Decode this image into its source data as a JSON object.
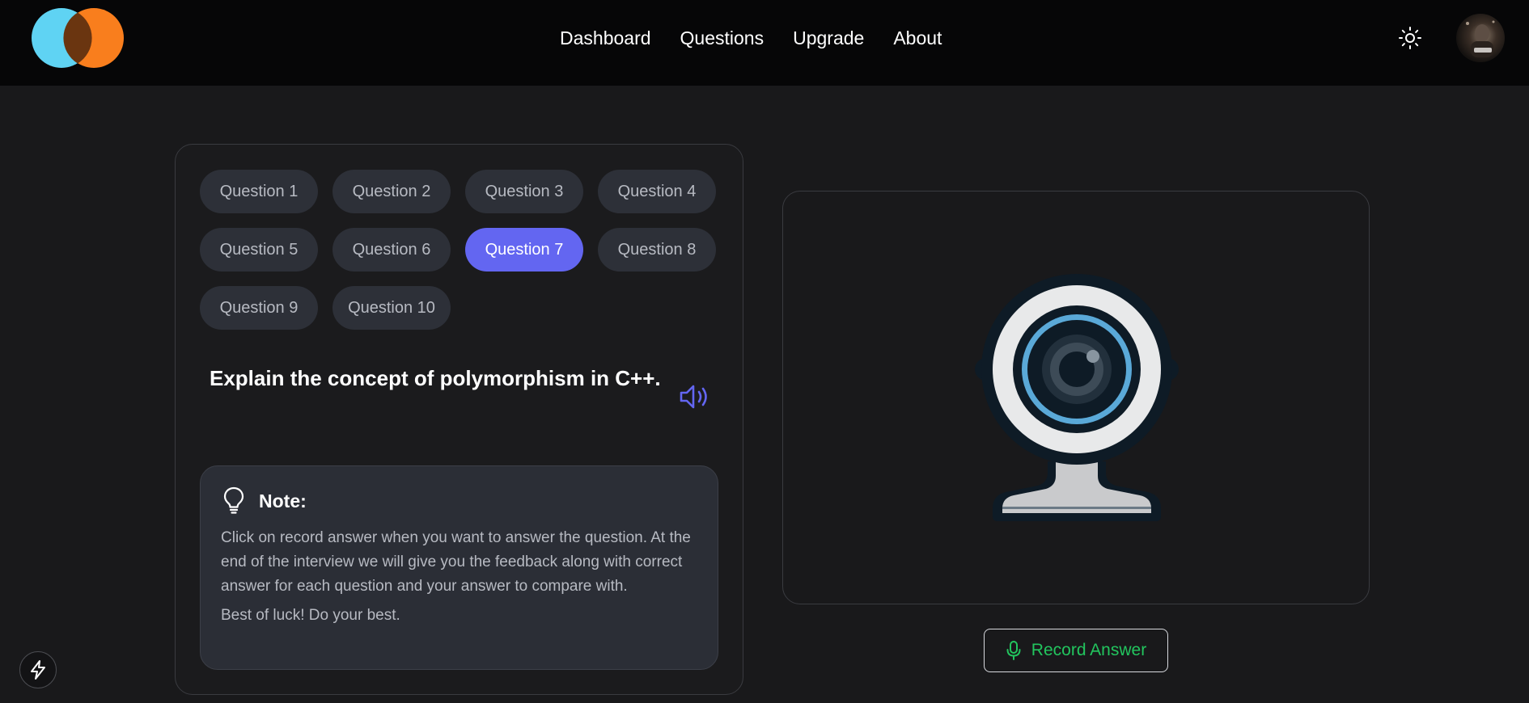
{
  "header": {
    "nav": [
      "Dashboard",
      "Questions",
      "Upgrade",
      "About"
    ],
    "logo_icon": "overlapping-circles-logo",
    "theme_icon": "sun-icon",
    "avatar_icon": "user-avatar"
  },
  "questions": {
    "labels": [
      "Question 1",
      "Question 2",
      "Question 3",
      "Question 4",
      "Question 5",
      "Question 6",
      "Question 7",
      "Question 8",
      "Question 9",
      "Question 10"
    ],
    "active_index": 6,
    "current_text": "Explain the concept of polymorphism in C++.",
    "speaker_icon": "speaker-icon"
  },
  "note": {
    "title": "Note:",
    "icon": "lightbulb-icon",
    "body": "Click on record answer when you want to answer the question. At the end of the interview we will give you the feedback along with correct answer for each question and your answer to compare with.",
    "closing": "Best of luck! Do your best."
  },
  "webcam": {
    "icon": "webcam-icon"
  },
  "record": {
    "label": "Record Answer",
    "icon": "microphone-icon"
  },
  "colors": {
    "accent": "#6366f1",
    "record_green": "#22c55e",
    "logo_cyan": "#5fd3f3",
    "logo_orange": "#f97e1d"
  },
  "bolt_icon": "lightning-bolt-icon"
}
